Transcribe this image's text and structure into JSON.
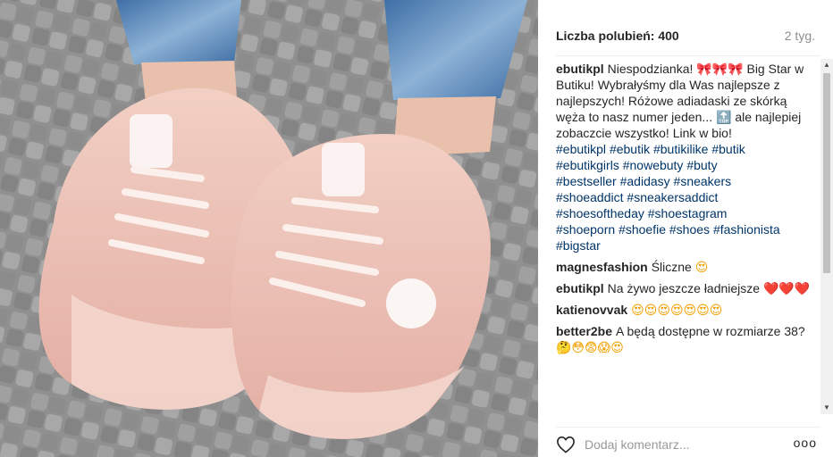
{
  "post": {
    "likes_text": "Liczba polubień: 400",
    "time_text": "2 tyg."
  },
  "comments": [
    {
      "user": "ebutikpl",
      "text_1": "Niespodzianka! ",
      "emoji_1": "🎀🎀🎀",
      "text_2": " Big Star w Butiku! Wybrałyśmy dla Was najlepsze z najlepszych! Różowe adiadaski ze skórką węża to nasz numer jeden... ",
      "emoji_2": "🔝",
      "text_3": " ale najlepiej zobaczcie wszystko! Link w bio!",
      "hashtags": [
        "#ebutikpl",
        "#ebutik",
        "#butikilike",
        "#butik",
        "#ebutikgirls",
        "#nowebuty",
        "#buty",
        "#bestseller",
        "#adidasy",
        "#sneakers",
        "#shoeaddict",
        "#sneakersaddict",
        "#shoesoftheday",
        "#shoestagram",
        "#shoeporn",
        "#shoefie",
        "#shoes",
        "#fashionista",
        "#bigstar"
      ]
    },
    {
      "user": "magnesfashion",
      "text": "Śliczne",
      "emoji": "😍"
    },
    {
      "user": "ebutikpl",
      "text": "Na żywo jeszcze ładniejsze",
      "emoji": "❤️❤️❤️"
    },
    {
      "user": "katienovvak",
      "text": "",
      "emoji": "😍😍😍😍😍😍😍"
    },
    {
      "user": "better2be",
      "text": "A będą dostępne w rozmiarze 38?",
      "emoji": "🤔😳😨😱😍"
    }
  ],
  "footer": {
    "comment_placeholder": "Dodaj komentarz...",
    "more_label": "ooo"
  },
  "icons": {
    "heart": "heart-icon",
    "scroll_up": "scroll-up-arrow-icon",
    "scroll_down": "scroll-down-arrow-icon"
  },
  "colors": {
    "link": "#003569",
    "muted": "#8e8e8e",
    "text": "#262626"
  }
}
